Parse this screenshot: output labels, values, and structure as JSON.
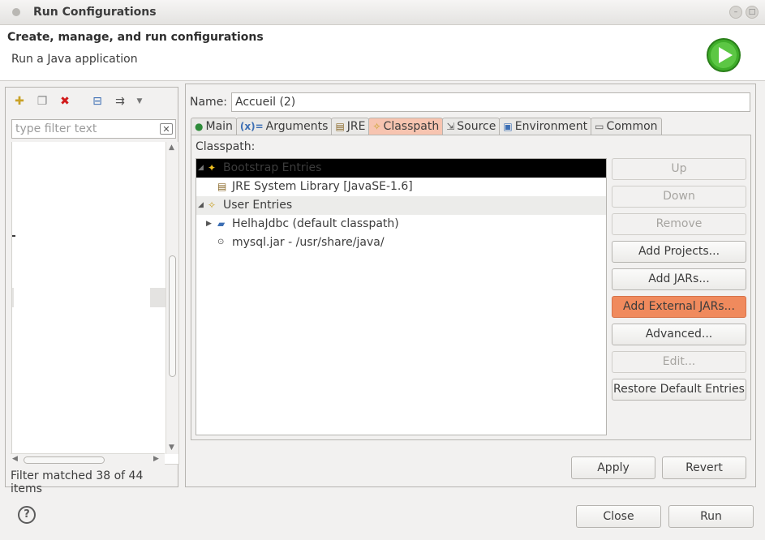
{
  "window": {
    "title": "Run Configurations"
  },
  "banner": {
    "title": "Create, manage, and run configurations",
    "subtitle": "Run a Java application"
  },
  "left": {
    "toolbar_icons": [
      "new-config-icon",
      "duplicate-icon",
      "delete-icon",
      "collapse-all-icon",
      "filter-icon",
      "dropdown-arrow-icon"
    ],
    "filter_placeholder": "type filter text",
    "filter_value": "",
    "status": "Filter matched 38 of 44 items"
  },
  "config": {
    "name_label": "Name:",
    "name_value": "Accueil (2)",
    "tabs": [
      {
        "label": "Main",
        "icon": "main-icon",
        "active": false
      },
      {
        "label": "Arguments",
        "icon": "arguments-icon",
        "active": false
      },
      {
        "label": "JRE",
        "icon": "jre-icon",
        "active": false
      },
      {
        "label": "Classpath",
        "icon": "classpath-icon",
        "active": true
      },
      {
        "label": "Source",
        "icon": "source-icon",
        "active": false
      },
      {
        "label": "Environment",
        "icon": "environment-icon",
        "active": false
      },
      {
        "label": "Common",
        "icon": "common-icon",
        "active": false
      }
    ],
    "classpath_label": "Classpath:",
    "entries": [
      {
        "label": "Bootstrap Entries",
        "type": "group",
        "expanded": true,
        "selected": true
      },
      {
        "label": "JRE System Library [JavaSE-1.6]",
        "type": "library"
      },
      {
        "label": "User Entries",
        "type": "group",
        "expanded": true
      },
      {
        "label": "HelhaJdbc (default classpath)",
        "type": "project",
        "expanded": false
      },
      {
        "label": "mysql.jar - /usr/share/java/",
        "type": "jar"
      }
    ],
    "side_buttons": [
      {
        "label": "Up",
        "enabled": false
      },
      {
        "label": "Down",
        "enabled": false
      },
      {
        "label": "Remove",
        "enabled": false
      },
      {
        "label": "Add Projects...",
        "enabled": true
      },
      {
        "label": "Add JARs...",
        "enabled": true
      },
      {
        "label": "Add External JARs...",
        "enabled": true,
        "highlighted": true
      },
      {
        "label": "Advanced...",
        "enabled": true
      },
      {
        "label": "Edit...",
        "enabled": false
      },
      {
        "label": "Restore Default Entries",
        "enabled": true
      }
    ],
    "apply_label": "Apply",
    "revert_label": "Revert"
  },
  "footer": {
    "close_label": "Close",
    "run_label": "Run"
  },
  "colors": {
    "active_tab": "#f7c4b0",
    "hover_button": "#f08a5d",
    "selection": "#000000",
    "run_icon": "#3fae2a"
  }
}
